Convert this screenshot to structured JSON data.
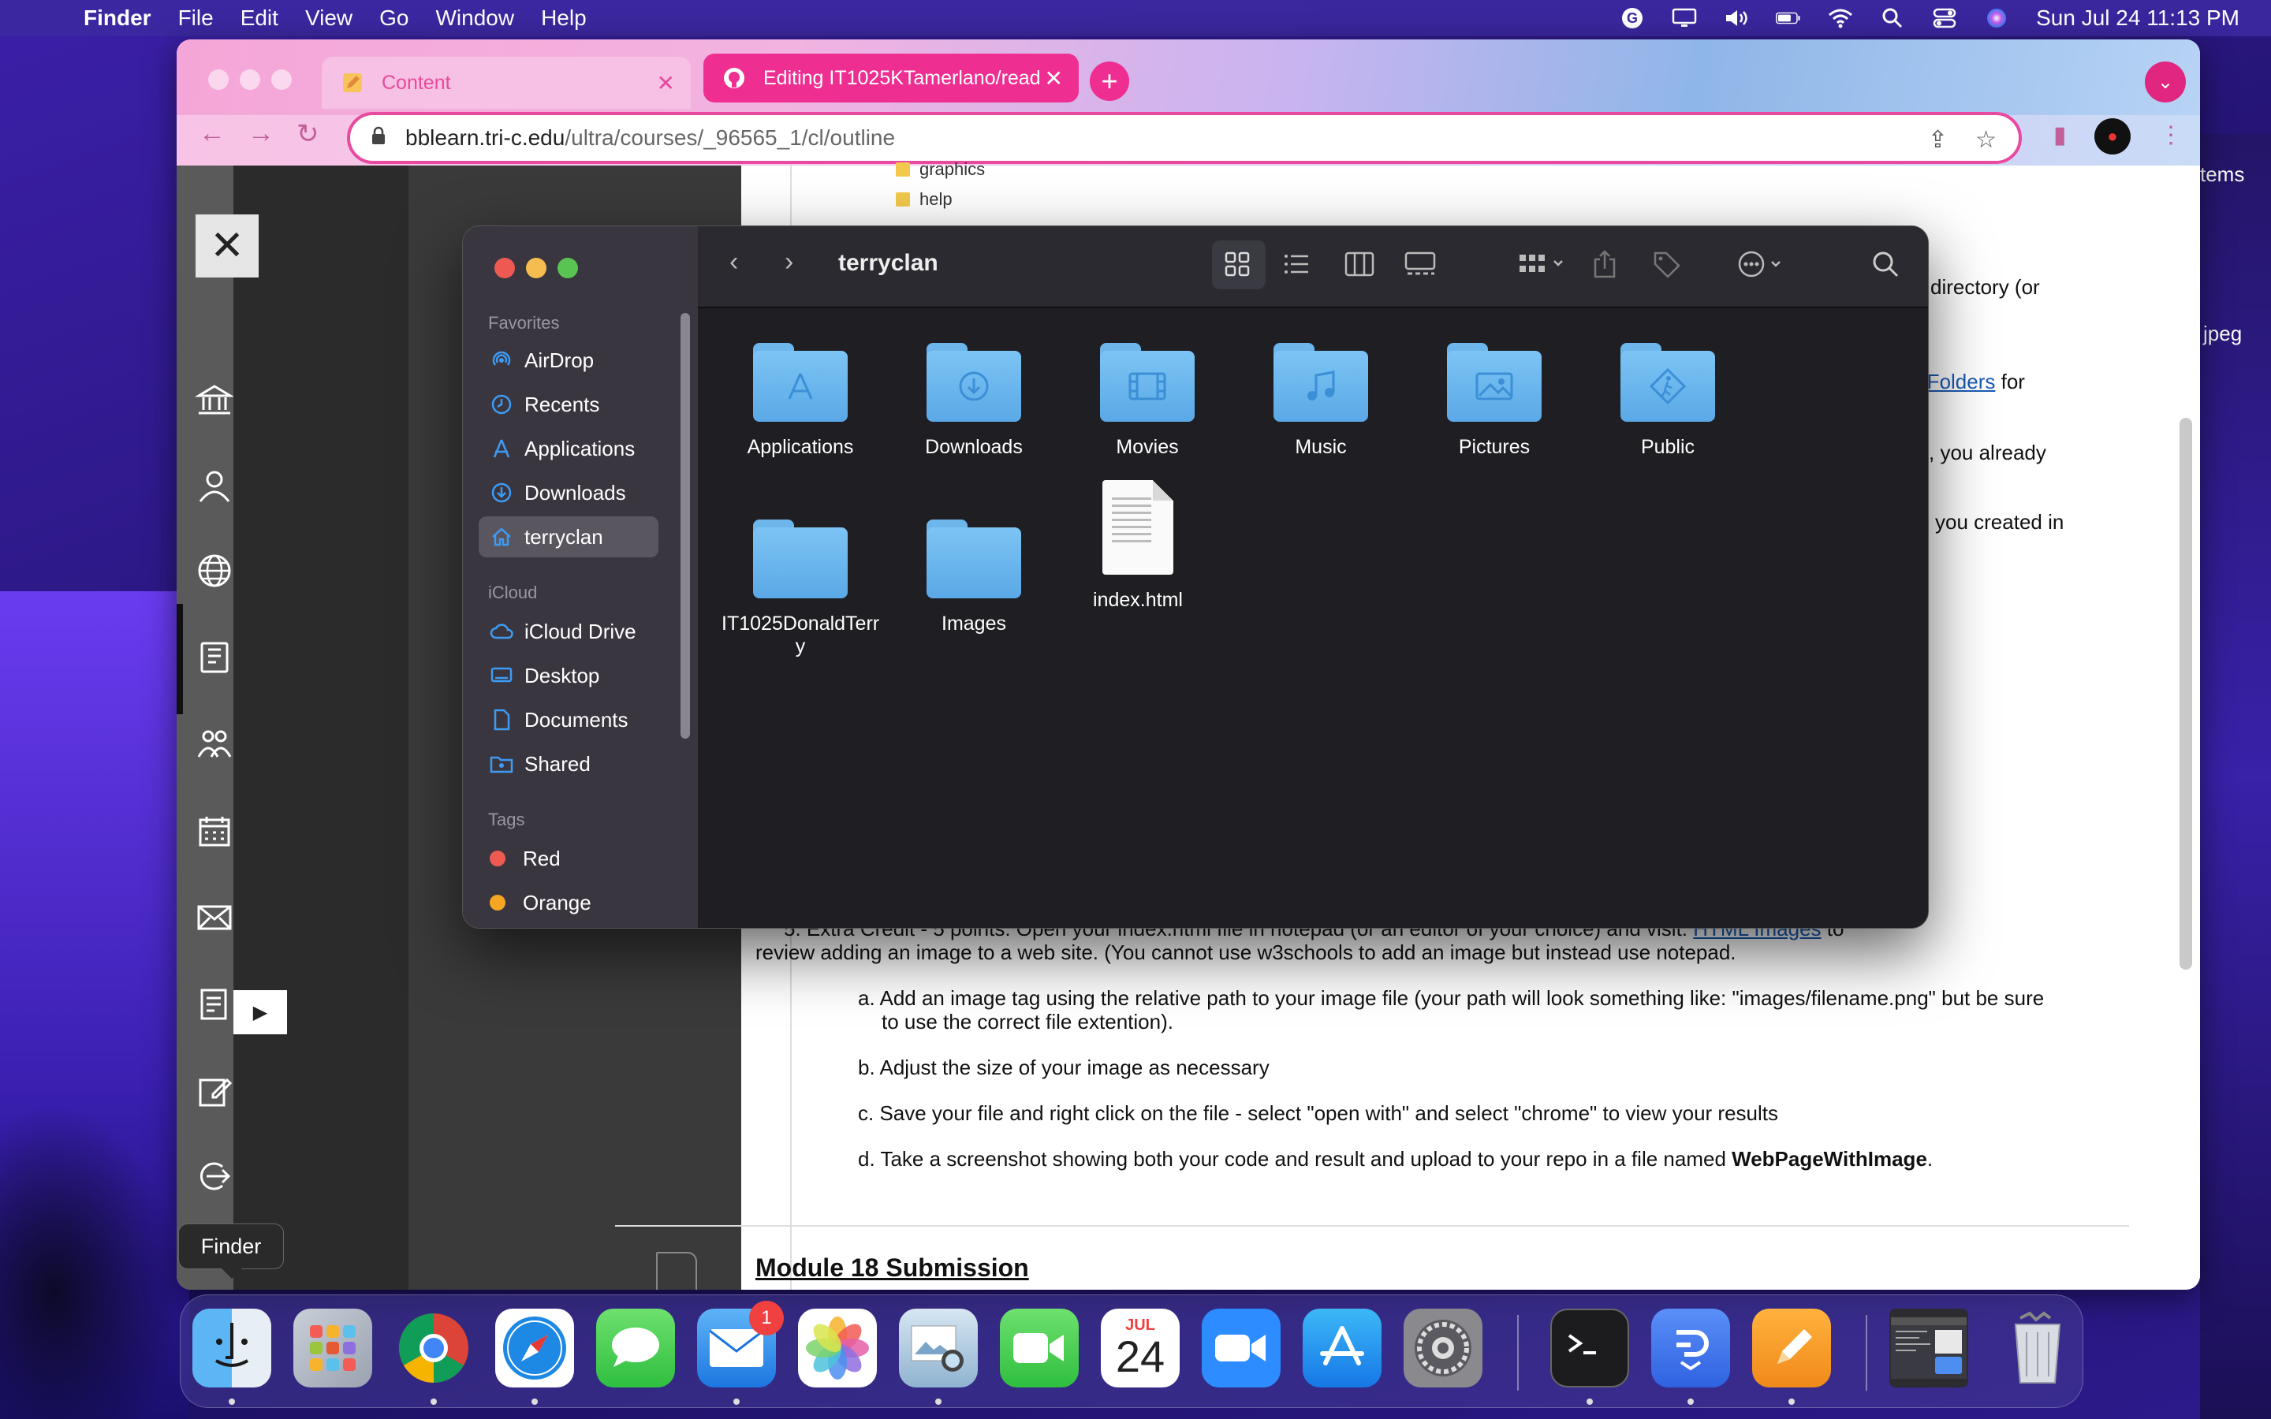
{
  "menubar": {
    "app": "Finder",
    "items": [
      "File",
      "Edit",
      "View",
      "Go",
      "Window",
      "Help"
    ],
    "clock": "Sun Jul 24  11:13 PM"
  },
  "browser": {
    "tabs": [
      {
        "label": "Content"
      },
      {
        "label": "Editing IT1025KTamerlano/read"
      }
    ],
    "url_host": "bblearn.tri-c.edu",
    "url_path": "/ultra/courses/_96565_1/cl/outline"
  },
  "page": {
    "folders_visible": [
      "graphics",
      "help"
    ],
    "right_fragments": {
      "f1": "directory (or",
      "f2_link": "d Folders",
      "f2_text": " for",
      "f3": ", you already",
      "f4": "you created in"
    },
    "extra_credit_line1_a": "5. Extra Credit - 5 points: Open your index.html file in notepad (or an editor of your choice) and visit: ",
    "extra_credit_link": "HTML Images",
    "extra_credit_line1_b": " to",
    "extra_credit_line2": "review adding an image to a web site.  (You cannot use w3schools to add an image but instead use notepad.",
    "steps": {
      "a1": "a. Add an image tag using the relative path to your image file (your path will look something like: \"images/filename.png\" but be sure",
      "a2": "to use the correct file extention).",
      "b": "b. Adjust the size of your image as necessary",
      "c": "c. Save your file and right click on the file - select \"open with\" and select \"chrome\" to view your results",
      "d_text": "d. Take a screenshot showing both your code and result and upload to your repo in a file named ",
      "d_bold": "WebPageWithImage",
      "d_end": "."
    },
    "module_submission": "Module 18 Submission"
  },
  "desktop_fragments": {
    "items": "tems",
    "jpeg": "jpeg"
  },
  "finder": {
    "title": "terryclan",
    "sections": {
      "favorites": "Favorites",
      "icloud": "iCloud",
      "tags": "Tags"
    },
    "favorites": [
      {
        "label": "AirDrop",
        "icon": "airdrop-icon"
      },
      {
        "label": "Recents",
        "icon": "clock-icon"
      },
      {
        "label": "Applications",
        "icon": "applications-icon"
      },
      {
        "label": "Downloads",
        "icon": "download-icon"
      },
      {
        "label": "terryclan",
        "icon": "home-icon"
      }
    ],
    "icloud": [
      {
        "label": "iCloud Drive",
        "icon": "cloud-icon"
      },
      {
        "label": "Desktop",
        "icon": "desktop-icon"
      },
      {
        "label": "Documents",
        "icon": "document-icon"
      },
      {
        "label": "Shared",
        "icon": "shared-folder-icon"
      }
    ],
    "tags": [
      {
        "label": "Red",
        "color": "#ee5a52"
      },
      {
        "label": "Orange",
        "color": "#f5a623"
      }
    ],
    "items": [
      {
        "label": "Applications",
        "kind": "folder",
        "glyph": "A"
      },
      {
        "label": "Downloads",
        "kind": "folder",
        "glyph": "download"
      },
      {
        "label": "Movies",
        "kind": "folder",
        "glyph": "film"
      },
      {
        "label": "Music",
        "kind": "folder",
        "glyph": "note"
      },
      {
        "label": "Pictures",
        "kind": "folder",
        "glyph": "photo"
      },
      {
        "label": "Public",
        "kind": "folder",
        "glyph": "walk"
      },
      {
        "label_line1": "IT1025DonaldTerr",
        "label_line2": "y",
        "kind": "folder"
      },
      {
        "label": "Images",
        "kind": "folder"
      },
      {
        "label": "index.html",
        "kind": "html-file"
      }
    ]
  },
  "dock": {
    "tooltip": "Finder",
    "mail_badge": "1",
    "calendar_month": "JUL",
    "calendar_day": "24"
  }
}
